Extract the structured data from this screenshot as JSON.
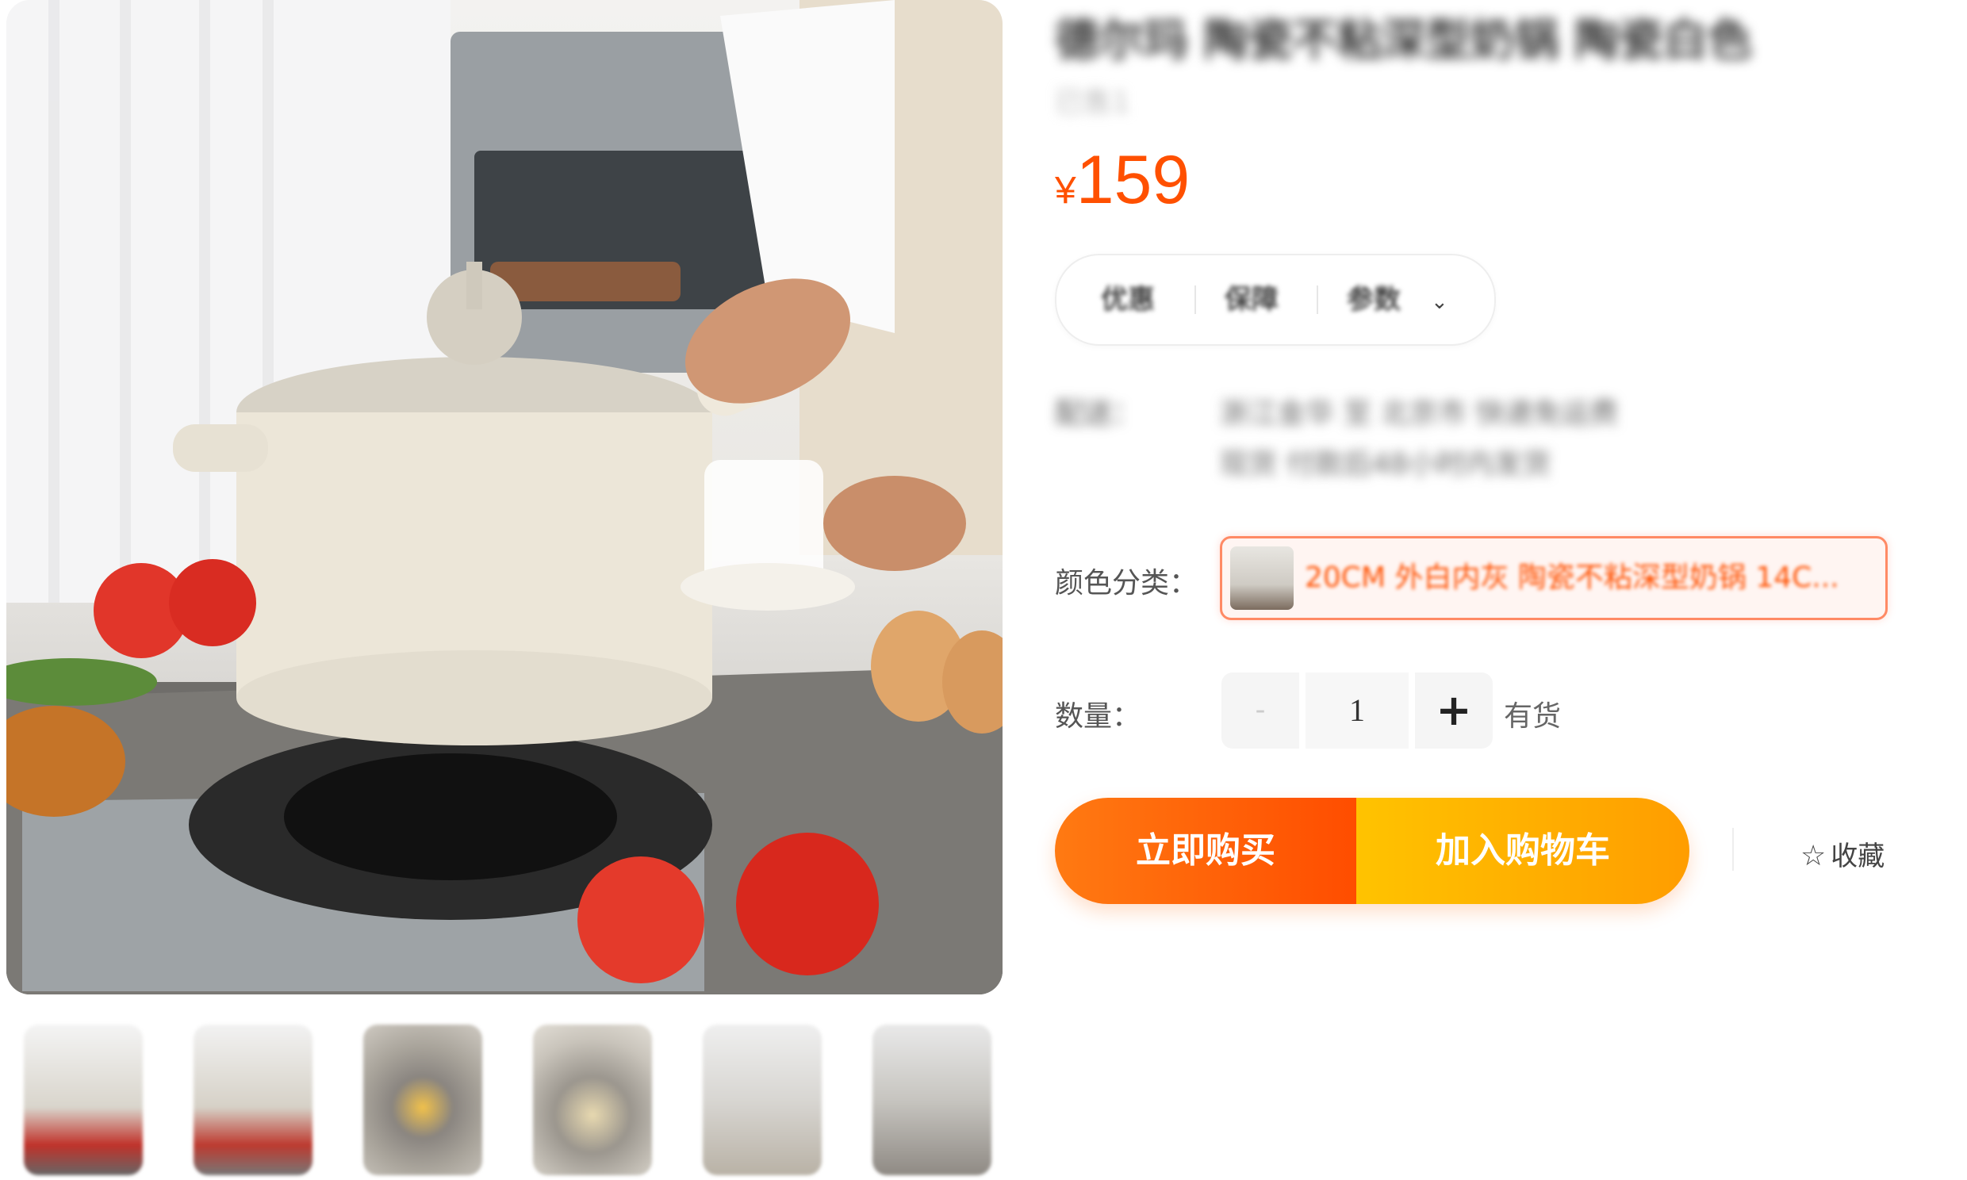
{
  "product": {
    "title": "德尔玛 陶瓷不粘深型奶锅 陶瓷白色",
    "subtitle": "已售1",
    "price_symbol": "¥",
    "price": "159"
  },
  "tabs": {
    "items": [
      "优惠",
      "保障",
      "参数"
    ],
    "chevron_icon": "chevron-down-icon"
  },
  "shipping": {
    "label": "配送：",
    "line1": "浙江金华 至 北京市 快递免运费",
    "line2": "现货 付款后48小时内发货"
  },
  "color": {
    "label": "颜色分类：",
    "selected": "20CM 外白内灰 陶瓷不粘深型奶锅 14C..."
  },
  "quantity": {
    "label": "数量：",
    "minus": "-",
    "value": "1",
    "plus": "+",
    "stock": "有货"
  },
  "actions": {
    "buy_now": "立即购买",
    "add_to_cart": "加入购物车",
    "favorite": "收藏",
    "favorite_icon": "star-outline-icon"
  },
  "colors": {
    "price": "#ff5000",
    "buy_gradient": [
      "#ff7a12",
      "#ff4d00"
    ],
    "cart_gradient": [
      "#ffc300",
      "#ff9d00"
    ]
  }
}
